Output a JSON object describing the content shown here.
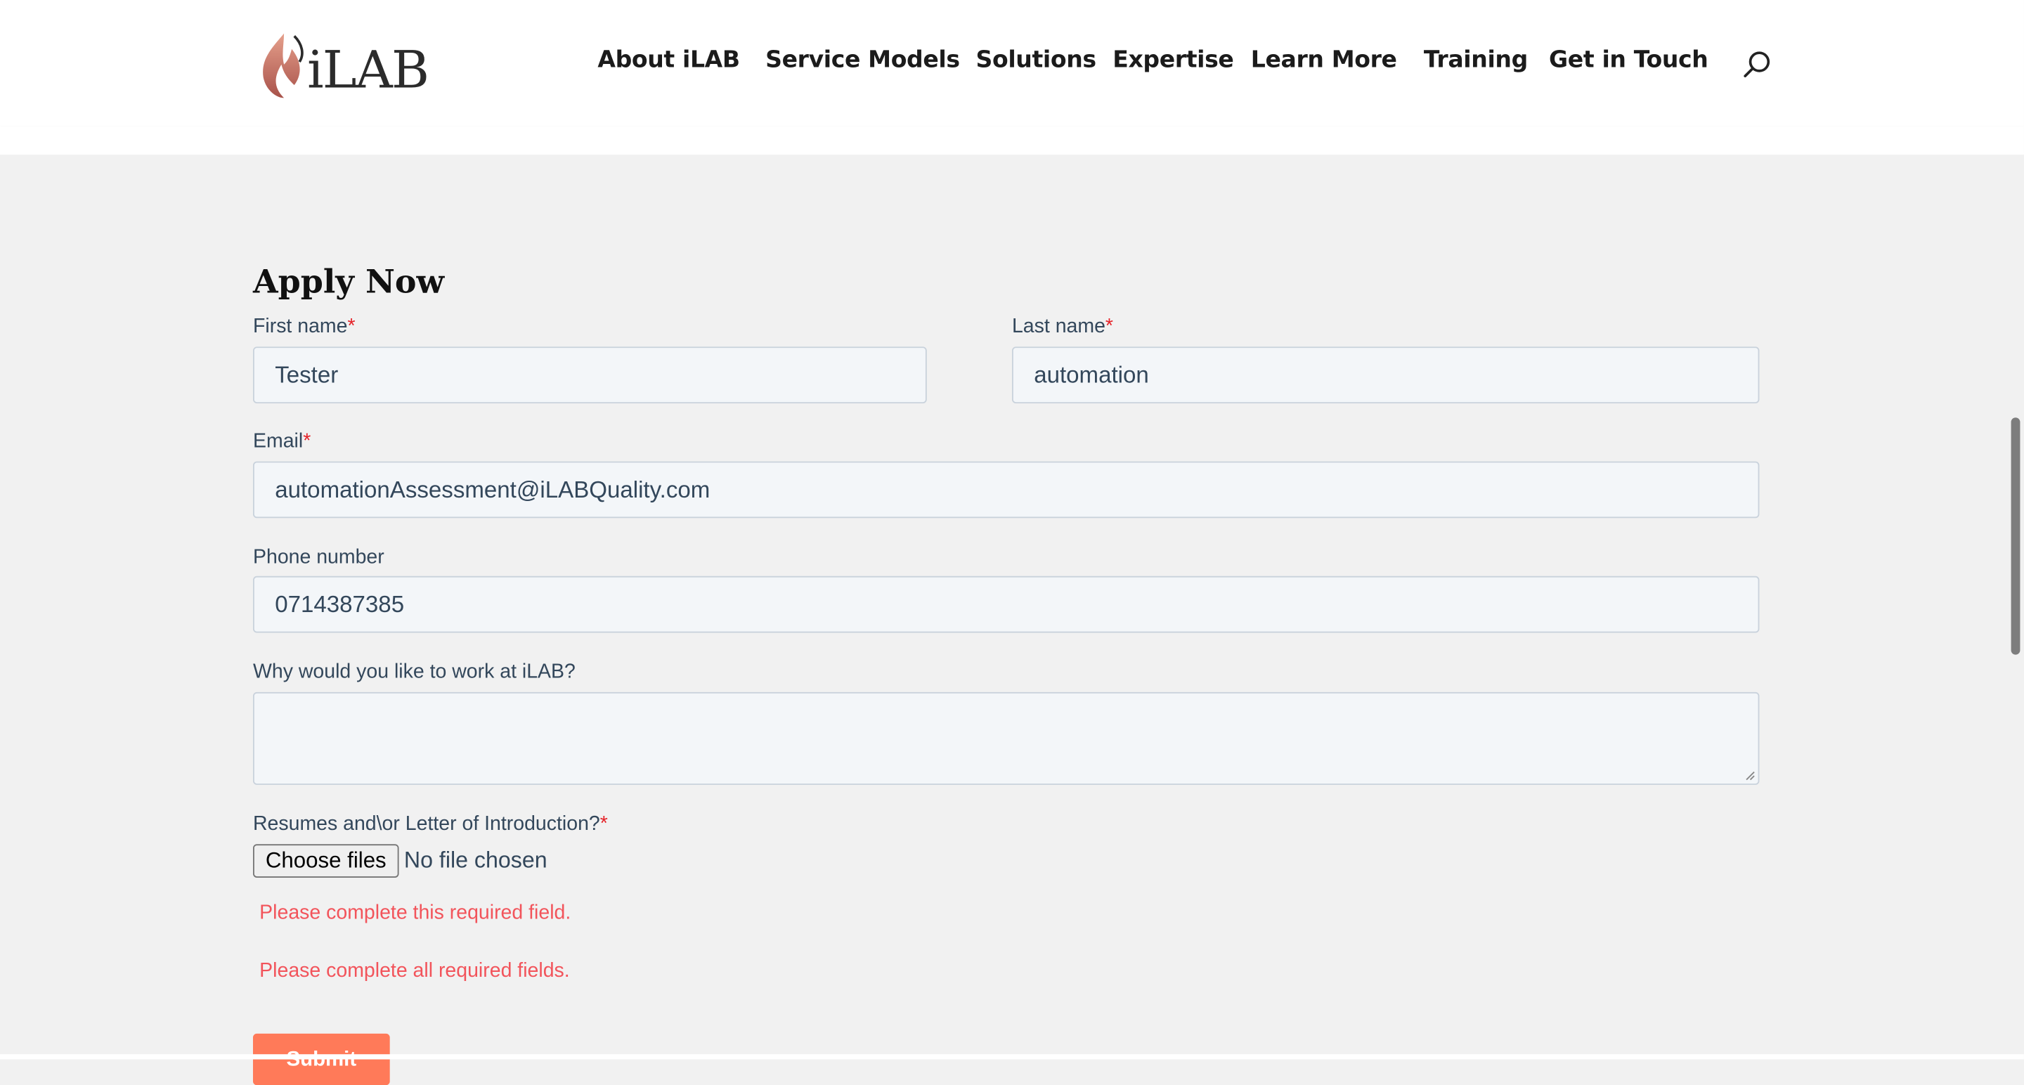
{
  "logo": {
    "text": "iLAB",
    "icon": "flame-icon"
  },
  "nav": {
    "items": [
      {
        "label": "About iLAB"
      },
      {
        "label": "Service Models"
      },
      {
        "label": "Solutions"
      },
      {
        "label": "Expertise"
      },
      {
        "label": "Learn More"
      },
      {
        "label": "Training"
      },
      {
        "label": "Get in Touch"
      }
    ],
    "search_icon": "search-icon"
  },
  "form": {
    "title": "Apply Now",
    "required_mark": "*",
    "first_name": {
      "label": "First name",
      "value": "Tester"
    },
    "last_name": {
      "label": "Last name",
      "value": "automation"
    },
    "email": {
      "label": "Email",
      "value": "automationAssessment@iLABQuality.com"
    },
    "phone": {
      "label": "Phone number",
      "value": "0714387385"
    },
    "why": {
      "label": "Why would you like to work at iLAB?",
      "value": ""
    },
    "resume": {
      "label": "Resumes and\\or Letter of Introduction?",
      "button": "Choose files",
      "status": "No file chosen"
    },
    "errors": {
      "field": "Please complete this required field.",
      "form": "Please complete all required fields."
    },
    "submit_label": "Submit"
  },
  "colors": {
    "accent": "#ff7a59",
    "error": "#f2545b",
    "required": "#e5242a",
    "field_bg": "#f3f6f9"
  }
}
